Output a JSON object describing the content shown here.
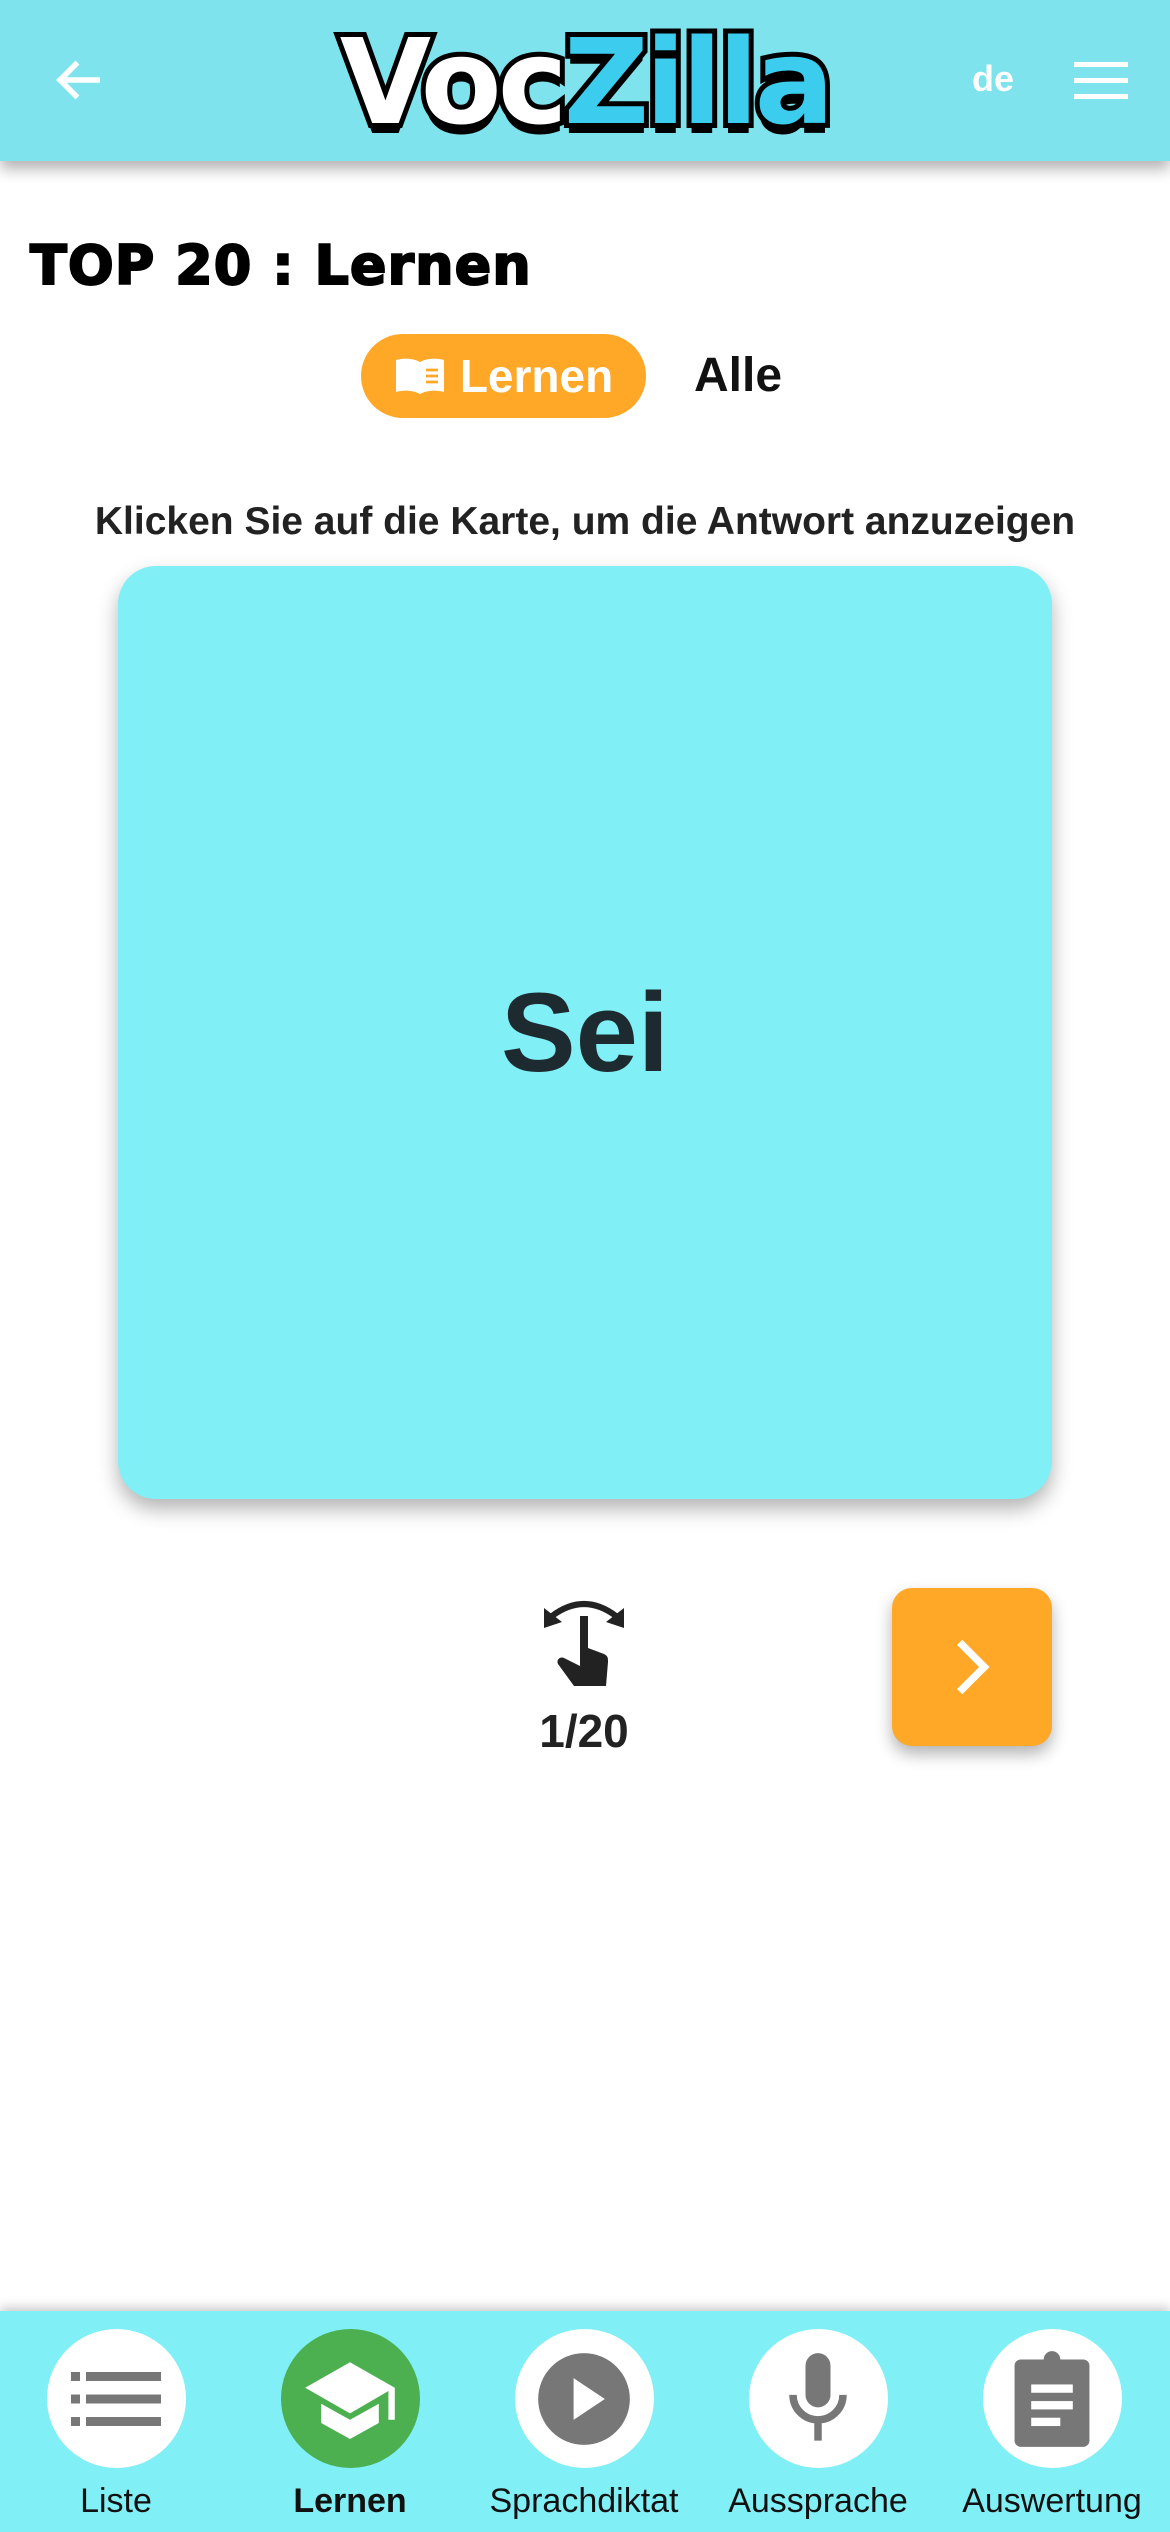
{
  "header": {
    "logo_part1": "Voc",
    "logo_part2": "Zilla",
    "language": "de",
    "back_icon": "arrow-left-icon",
    "menu_icon": "hamburger-icon"
  },
  "page": {
    "title": "TOP 20 : Lernen"
  },
  "mode_toggle": {
    "active_label": "Lernen",
    "active_icon": "book-icon",
    "other_label": "Alle"
  },
  "hint": "Klicken Sie auf die Karte, um die Antwort anzuzeigen",
  "card": {
    "word": "Sei"
  },
  "progress": {
    "label": "1/20",
    "current": 1,
    "total": 20,
    "icon": "tap-flip-icon"
  },
  "next_icon": "chevron-right-icon",
  "colors": {
    "header": "#7fe3ee",
    "accent": "#ffa726",
    "card": "#80eff6",
    "active_nav": "#4caf50"
  },
  "nav": {
    "items": [
      {
        "label": "Liste",
        "icon": "list-icon"
      },
      {
        "label": "Lernen",
        "icon": "graduation-cap-icon",
        "active": true
      },
      {
        "label": "Sprachdiktat",
        "icon": "play-icon"
      },
      {
        "label": "Aussprache",
        "icon": "microphone-icon"
      },
      {
        "label": "Auswertung",
        "icon": "clipboard-icon"
      }
    ]
  }
}
